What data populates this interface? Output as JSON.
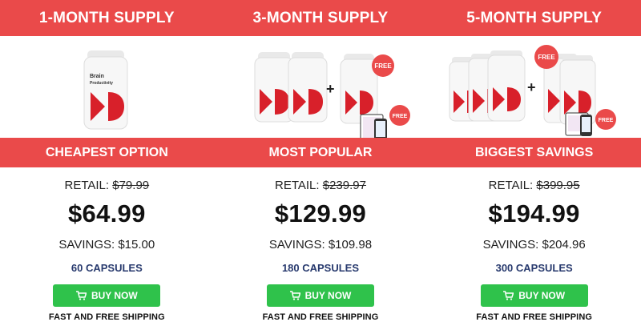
{
  "tiers": [
    {
      "title": "1-MONTH SUPPLY",
      "label": "CHEAPEST OPTION",
      "retail_label": "RETAIL:",
      "retail_price": "$79.99",
      "price": "$64.99",
      "savings": "SAVINGS: $15.00",
      "capsules": "60 CAPSULES",
      "buy_label": "BUY NOW",
      "shipping": "FAST AND FREE SHIPPING"
    },
    {
      "title": "3-MONTH SUPPLY",
      "label": "MOST POPULAR",
      "retail_label": "RETAIL:",
      "retail_price": "$239.97",
      "price": "$129.99",
      "savings": "SAVINGS: $109.98",
      "capsules": "180 CAPSULES",
      "buy_label": "BUY NOW",
      "shipping": "FAST AND FREE SHIPPING"
    },
    {
      "title": "5-MONTH SUPPLY",
      "label": "BIGGEST SAVINGS",
      "retail_label": "RETAIL:",
      "retail_price": "$399.95",
      "price": "$194.99",
      "savings": "SAVINGS: $204.96",
      "capsules": "300 CAPSULES",
      "buy_label": "BUY NOW",
      "shipping": "FAST AND FREE SHIPPING"
    }
  ],
  "product": {
    "bottle_label_1": "Brain",
    "bottle_label_2": "Productivity"
  },
  "badges": {
    "free": "FREE",
    "plus": "+"
  },
  "colors": {
    "band_red": "#ea4a4a",
    "buy_green": "#2fc24b",
    "capsule_text": "#283a6e"
  },
  "icons": {
    "buy": "cart-icon"
  }
}
